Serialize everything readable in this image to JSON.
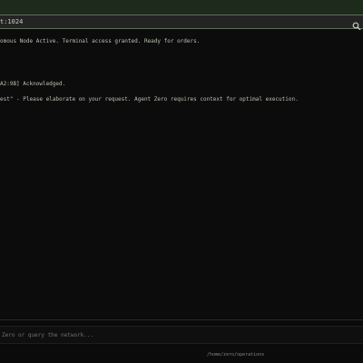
{
  "address_bar": {
    "text": "t:1024",
    "icon": "search-icon"
  },
  "terminal": {
    "lines": [
      "omous Node Active. Terminal access granted. Ready for orders.",
      "A2:9B] Acknowledged.",
      "est\" - Please elaborate on your request. Agent Zero requires context for optimal execution."
    ]
  },
  "command_input": {
    "placeholder": "Zero or query the network..."
  },
  "status_bar": {
    "path": "/home/zero/operations"
  },
  "colors": {
    "top_band": "#1d2a1c",
    "address_border": "#5c6f58",
    "terminal_bg": "#0c0c0c",
    "terminal_text": "#b6c0b0"
  }
}
